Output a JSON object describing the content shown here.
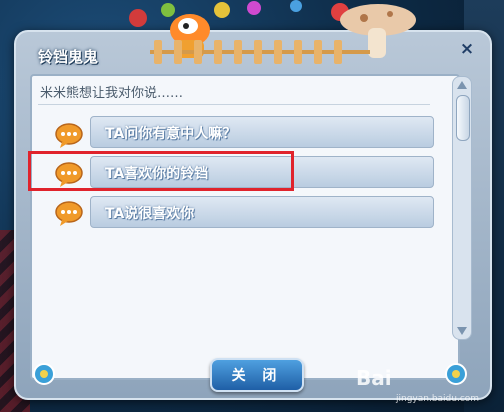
{
  "dialog": {
    "title": "铃铛鬼鬼",
    "close_glyph": "×",
    "prompt": "米米熊想让我对你说……",
    "options": [
      {
        "label": "TA问你有意中人嘛？"
      },
      {
        "label": "TA喜欢你的铃铛"
      },
      {
        "label": "TA说很喜欢你"
      }
    ],
    "close_button_label": "关 闭"
  },
  "watermark": {
    "brand": "Bai",
    "sub": "jingyan.baidu.com"
  },
  "colors": {
    "highlight": "#e0232c",
    "button_blue": "#1f5fa6",
    "option_text": "#ffffff"
  },
  "icons": [
    "speech-bubble-icon",
    "close-icon",
    "scroll-up-icon",
    "scroll-down-icon",
    "ornament-icon"
  ]
}
